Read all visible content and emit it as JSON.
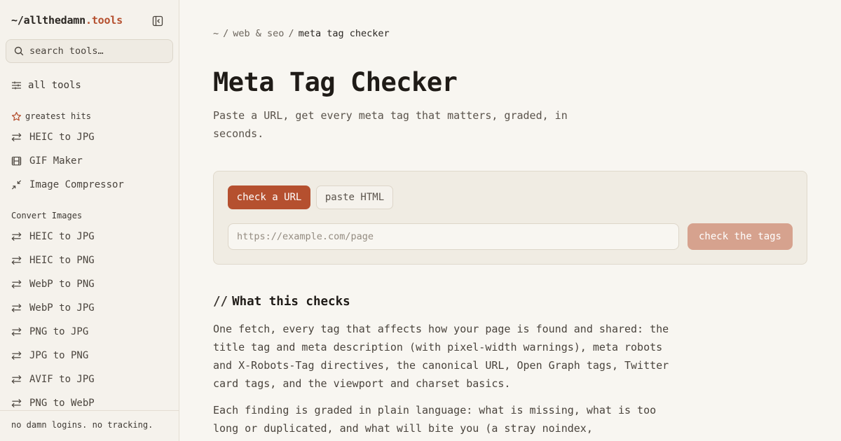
{
  "brand": {
    "prefix": "~/allthedamn",
    "accent": ".tools"
  },
  "search": {
    "placeholder": "search tools…"
  },
  "nav": {
    "all_tools": "all tools",
    "greatest_hits_label": "greatest hits",
    "greatest_hits": [
      {
        "label": "HEIC to JPG",
        "icon": "arrows-icon"
      },
      {
        "label": "GIF Maker",
        "icon": "film-icon"
      },
      {
        "label": "Image Compressor",
        "icon": "compress-icon"
      }
    ],
    "convert_label": "Convert Images",
    "convert": [
      {
        "label": "HEIC to JPG",
        "icon": "arrows-icon"
      },
      {
        "label": "HEIC to PNG",
        "icon": "arrows-icon"
      },
      {
        "label": "WebP to PNG",
        "icon": "arrows-icon"
      },
      {
        "label": "WebP to JPG",
        "icon": "arrows-icon"
      },
      {
        "label": "PNG to JPG",
        "icon": "arrows-icon"
      },
      {
        "label": "JPG to PNG",
        "icon": "arrows-icon"
      },
      {
        "label": "AVIF to JPG",
        "icon": "arrows-icon"
      },
      {
        "label": "PNG to WebP",
        "icon": "arrows-icon"
      }
    ]
  },
  "footer": {
    "text": "no damn logins. no tracking."
  },
  "breadcrumb": {
    "home": "~",
    "sep": "/",
    "category": "web & seo",
    "current": "meta tag checker"
  },
  "page": {
    "title": "Meta Tag Checker",
    "subtitle": "Paste a URL, get every meta tag that matters, graded, in seconds."
  },
  "form": {
    "tab_active": "check a URL",
    "tab_inactive": "paste HTML",
    "url_placeholder": "https://example.com/page",
    "submit_label": "check the tags"
  },
  "checks": {
    "prefix": "//",
    "heading": "What this checks",
    "para1": "One fetch, every tag that affects how your page is found and shared: the title tag and meta description (with pixel-width warnings), meta robots and X-Robots-Tag directives, the canonical URL, Open Graph tags, Twitter card tags, and the viewport and charset basics.",
    "para2": "Each finding is graded in plain language: what is missing, what is too long or duplicated, and what will bite you (a stray noindex,"
  },
  "colors": {
    "accent": "#b5502f",
    "accent_disabled": "#d6a28e",
    "background": "#f8f6f1"
  }
}
